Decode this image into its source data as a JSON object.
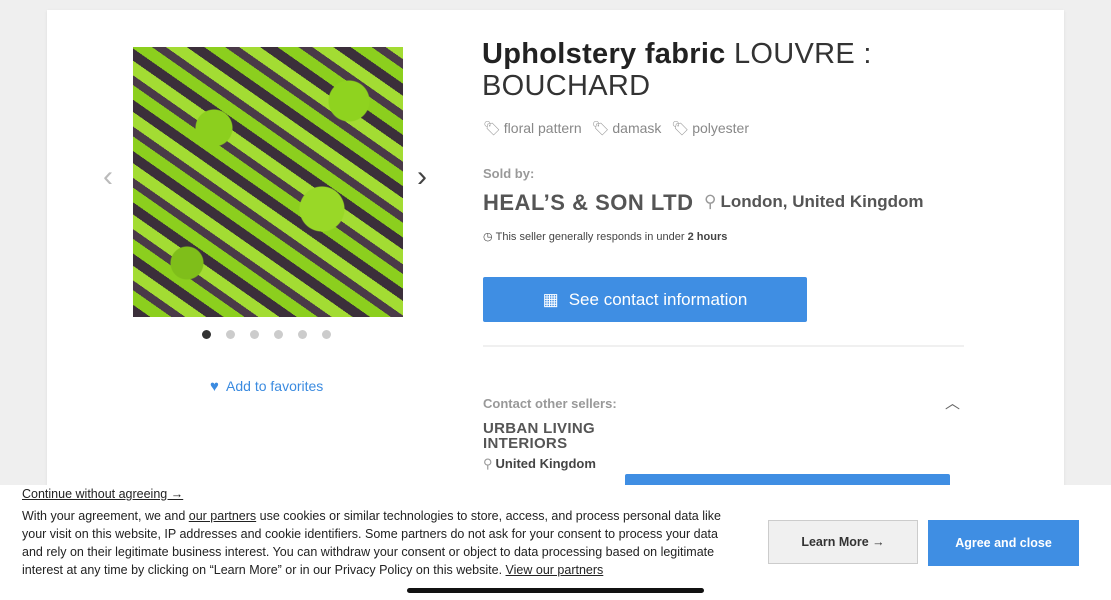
{
  "gallery": {
    "prev_icon": "chevron-left-icon",
    "next_icon": "chevron-right-icon",
    "dot_count": 6,
    "active_dot": 1,
    "favorites_label": "Add to favorites"
  },
  "product": {
    "title_bold": "Upholstery fabric",
    "title_rest": " LOUVRE : BOUCHARD",
    "tags": [
      "floral pattern",
      "damask",
      "polyester"
    ]
  },
  "seller": {
    "sold_by_label": "Sold by:",
    "name": "HEAL’S & SON LTD",
    "location": "London, United Kingdom",
    "response_prefix": "This seller generally responds in under ",
    "response_time": "2 hours",
    "contact_label": "See contact information"
  },
  "other_sellers": {
    "label": "Contact other sellers:",
    "items": [
      {
        "name": "URBAN LIVING INTERIORS",
        "location": "United Kingdom"
      }
    ]
  },
  "cookie_banner": {
    "continue_label": "Continue without agreeing →",
    "text_1": "With your agreement, we and ",
    "partners_link": "our partners",
    "text_2": " use cookies or similar technologies to store, access, and process personal data like your visit on this website, IP addresses and cookie identifiers. Some partners do not ask for your consent to process your data and rely on their legitimate business interest. You can withdraw your consent or object to data processing based on legitimate interest at any time by clicking on “Learn More” or in our Privacy Policy on this website. ",
    "view_partners_link": "View our partners",
    "learn_more_label": "Learn More →",
    "agree_label": "Agree and close"
  },
  "colors": {
    "accent": "#3f8ee3",
    "text": "#555555",
    "muted": "#999999"
  }
}
